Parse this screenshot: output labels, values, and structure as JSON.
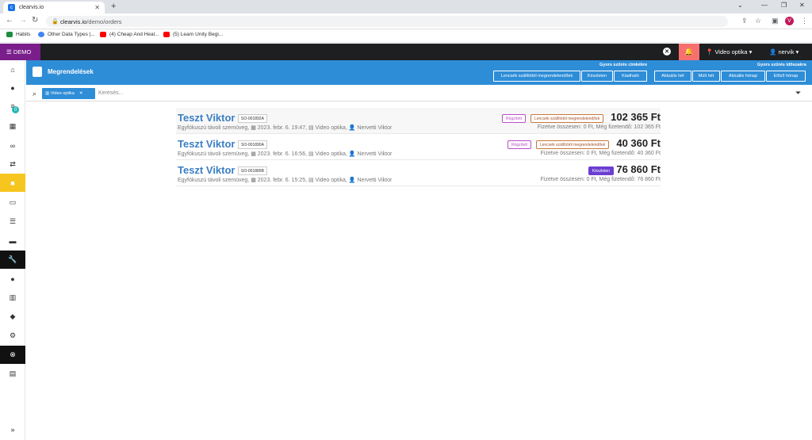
{
  "browser": {
    "tab_title": "clearvis.io",
    "url_host": "clearvis.io",
    "url_path": "/demo/orders",
    "profile_initial": "V",
    "bookmarks": [
      {
        "label": "Habits",
        "color": "#1e8e3e"
      },
      {
        "label": "Other Data Types |...",
        "color": "#4285f4"
      },
      {
        "label": "(4) Cheap And Heal...",
        "color": "#ff0000"
      },
      {
        "label": "(5) Learn Unity Begi...",
        "color": "#ff0000"
      }
    ]
  },
  "appbar": {
    "demo_label": "DEMO",
    "location_label": "Video optika",
    "user_label": "nervik"
  },
  "sidebar": {
    "badge_count": "0",
    "items": [
      "home-icon",
      "user-icon",
      "list-check-icon",
      "calendar-icon",
      "glasses-icon",
      "repeat-icon",
      "shopping-bag-icon",
      "money-icon",
      "list-icon",
      "briefcase-icon",
      "wrench-icon",
      "person-icon",
      "building-icon",
      "tag-icon",
      "gear-icon",
      "close-circle-icon",
      "database-icon"
    ],
    "expand_label": "»"
  },
  "header": {
    "title": "Megrendelések",
    "filter_group_label": "Gyors szűrés címkékre",
    "filter_buttons": [
      "Lencsék szállítótól megrendelendőek",
      "Készleten",
      "Kiadható"
    ],
    "time_group_label": "Gyors szűrés időszakra",
    "time_buttons": [
      "Aktuális hét",
      "Múlt hét",
      "Aktuális hónap",
      "Előző hónap"
    ]
  },
  "search": {
    "chip_label": "Video optika",
    "placeholder": "Keresés..."
  },
  "orders": [
    {
      "name": "Teszt Viktor",
      "code": "SO-001892A",
      "meta": "Egyfókuszú távoli szemüveg, ▦ 2023. febr. 6. 19:47, ▤ Video optika, 👤 Nervetti Viktor",
      "tags": [
        "Rögzített",
        "Lencsék szállítótól megrendelendőek"
      ],
      "price": "102 365 Ft",
      "paid": "Fizetve összesen: 0 Ft, Még fizetendő: 102 365 Ft"
    },
    {
      "name": "Teszt Viktor",
      "code": "SO-001890A",
      "meta": "Egyfókuszú távoli szemüveg, ▦ 2023. febr. 6. 16:56, ▤ Video optika, 👤 Nervetti Viktor",
      "tags": [
        "Rögzített",
        "Lencsék szállítótól megrendelendőek"
      ],
      "price": "40 360 Ft",
      "paid": "Fizetve összesen: 0 Ft, Még fizetendő: 40 360 Ft"
    },
    {
      "name": "Teszt Viktor",
      "code": "SO-001889B",
      "meta": "Egyfókuszú távoli szemüveg, ▦ 2023. febr. 6. 15:25, ▤ Video optika, 👤 Nervetti Viktor",
      "tags": [
        "Készleten"
      ],
      "price": "76 860 Ft",
      "paid": "Fizetve összesen: 0 Ft, Még fizetendő: 76 860 Ft"
    }
  ]
}
